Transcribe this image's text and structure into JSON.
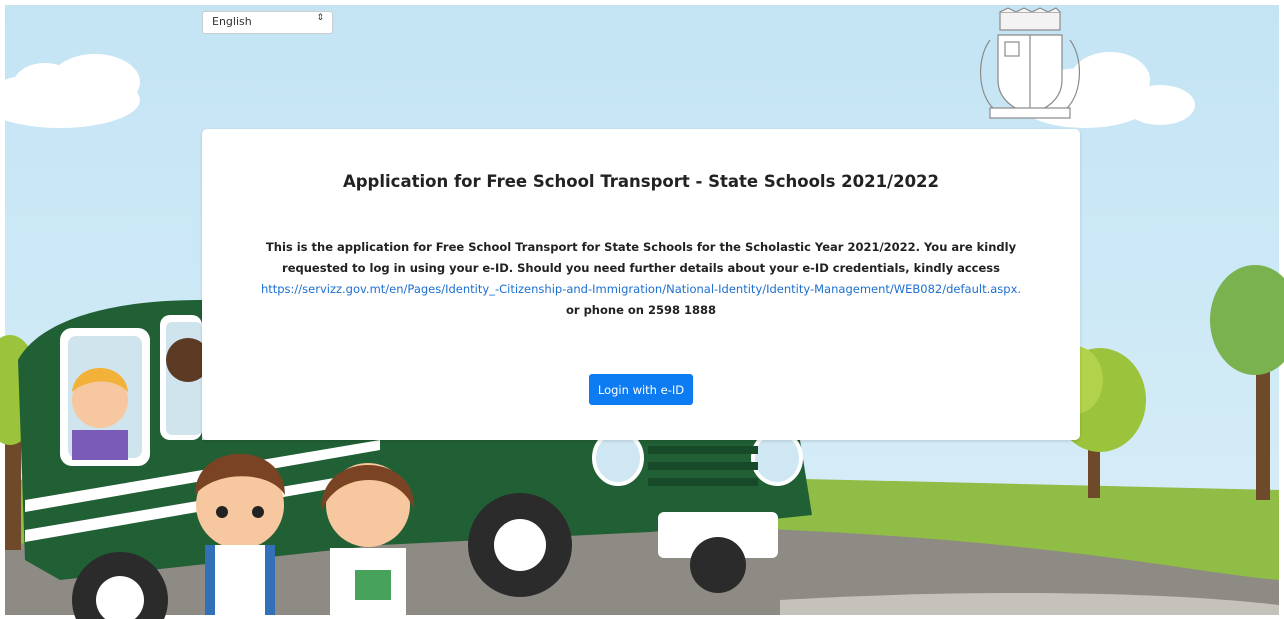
{
  "language_select": {
    "value": "English",
    "caret": "⇕"
  },
  "card": {
    "title": "Application for Free School Transport - State Schools 2021/2022",
    "intro": "This is the application for Free School Transport for State Schools for the Scholastic Year 2021/2022. You are kindly requested to log in using your e-ID. Should you need further details about your e-ID credentials, kindly access",
    "link": "https://servizz.gov.mt/en/Pages/Identity_-Citizenship-and-Immigration/National-Identity/Identity-Management/WEB082/default.aspx.",
    "phone_line": "or phone on 2598 1888",
    "login_button": "Login with e-ID"
  },
  "colors": {
    "primary_button": "#0d7cf2",
    "link": "#1c6fd0",
    "bus": "#1f5f33",
    "sky": "#c9e7f5"
  },
  "icons": {
    "emblem": "malta-coat-of-arms-icon"
  }
}
